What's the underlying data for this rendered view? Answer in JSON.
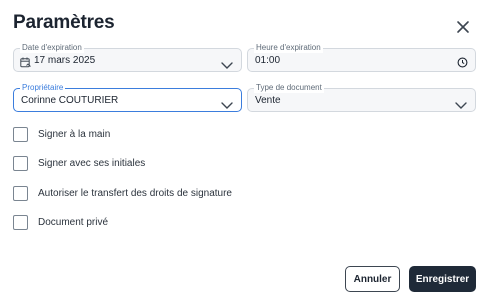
{
  "dialog": {
    "title": "Paramètres",
    "close_icon": "close-icon"
  },
  "fields": {
    "expiration_date": {
      "label": "Date d'expiration",
      "value": "17 mars 2025",
      "icon": "calendar-icon"
    },
    "expiration_time": {
      "label": "Heure d'expiration",
      "value": "01:00",
      "icon": "clock-icon"
    },
    "owner": {
      "label": "Propriétaire",
      "value": "Corinne COUTURIER"
    },
    "document_type": {
      "label": "Type de document",
      "value": "Vente"
    }
  },
  "options": {
    "sign_by_hand": "Signer à la main",
    "sign_with_initials": "Signer avec ses initiales",
    "allow_transfer": "Autoriser le transfert des droits de signature",
    "private_document": "Document privé"
  },
  "actions": {
    "cancel": "Annuler",
    "save": "Enregistrer"
  },
  "colors": {
    "accent": "#3b7ddd",
    "primary_button": "#1f2a38"
  }
}
